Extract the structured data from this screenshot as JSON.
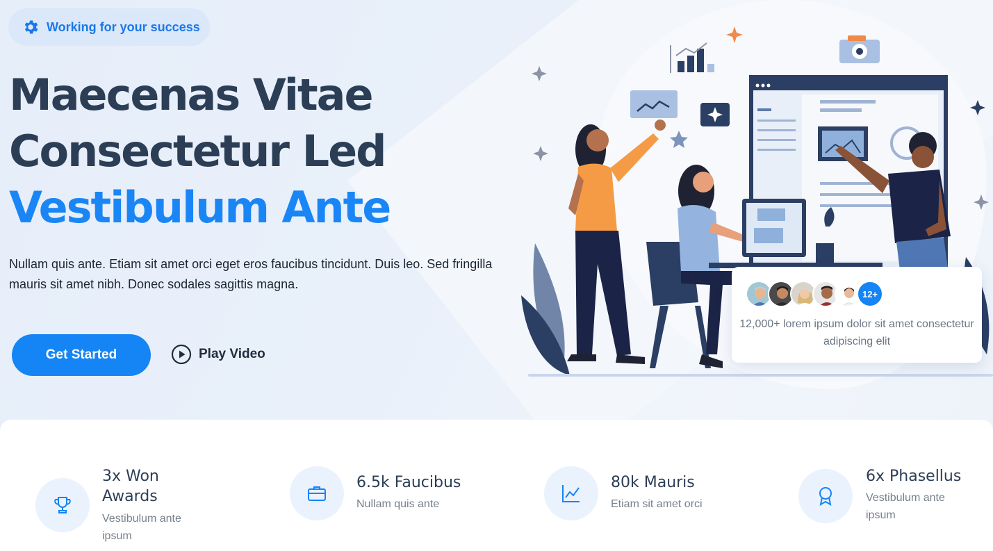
{
  "badge": {
    "text": "Working for your success",
    "icon": "gear-icon"
  },
  "headline": {
    "line1": "Maecenas Vitae",
    "line2": "Consectetur Led",
    "line3": "Vestibulum Ante"
  },
  "description": "Nullam quis ante. Etiam sit amet orci eget eros faucibus tincidunt. Duis leo. Sed fringilla mauris sit amet nibh. Donec sodales sagittis magna.",
  "cta": {
    "primary_label": "Get Started",
    "secondary_label": "Play Video"
  },
  "social_proof": {
    "avatar_count_badge": "12+",
    "text": "12,000+ lorem ipsum dolor sit amet consectetur adipiscing elit"
  },
  "stats": [
    {
      "icon": "trophy-icon",
      "title": "3x Won Awards",
      "subtitle": "Vestibulum ante ipsum"
    },
    {
      "icon": "briefcase-icon",
      "title": "6.5k Faucibus",
      "subtitle": "Nullam quis ante"
    },
    {
      "icon": "chart-line-icon",
      "title": "80k Mauris",
      "subtitle": "Etiam sit amet orci"
    },
    {
      "icon": "award-icon",
      "title": "6x Phasellus",
      "subtitle": "Vestibulum ante ipsum"
    }
  ],
  "colors": {
    "accent": "#1584f5",
    "heading": "#2c3e55",
    "hero_bg": "#e9f0fa"
  }
}
